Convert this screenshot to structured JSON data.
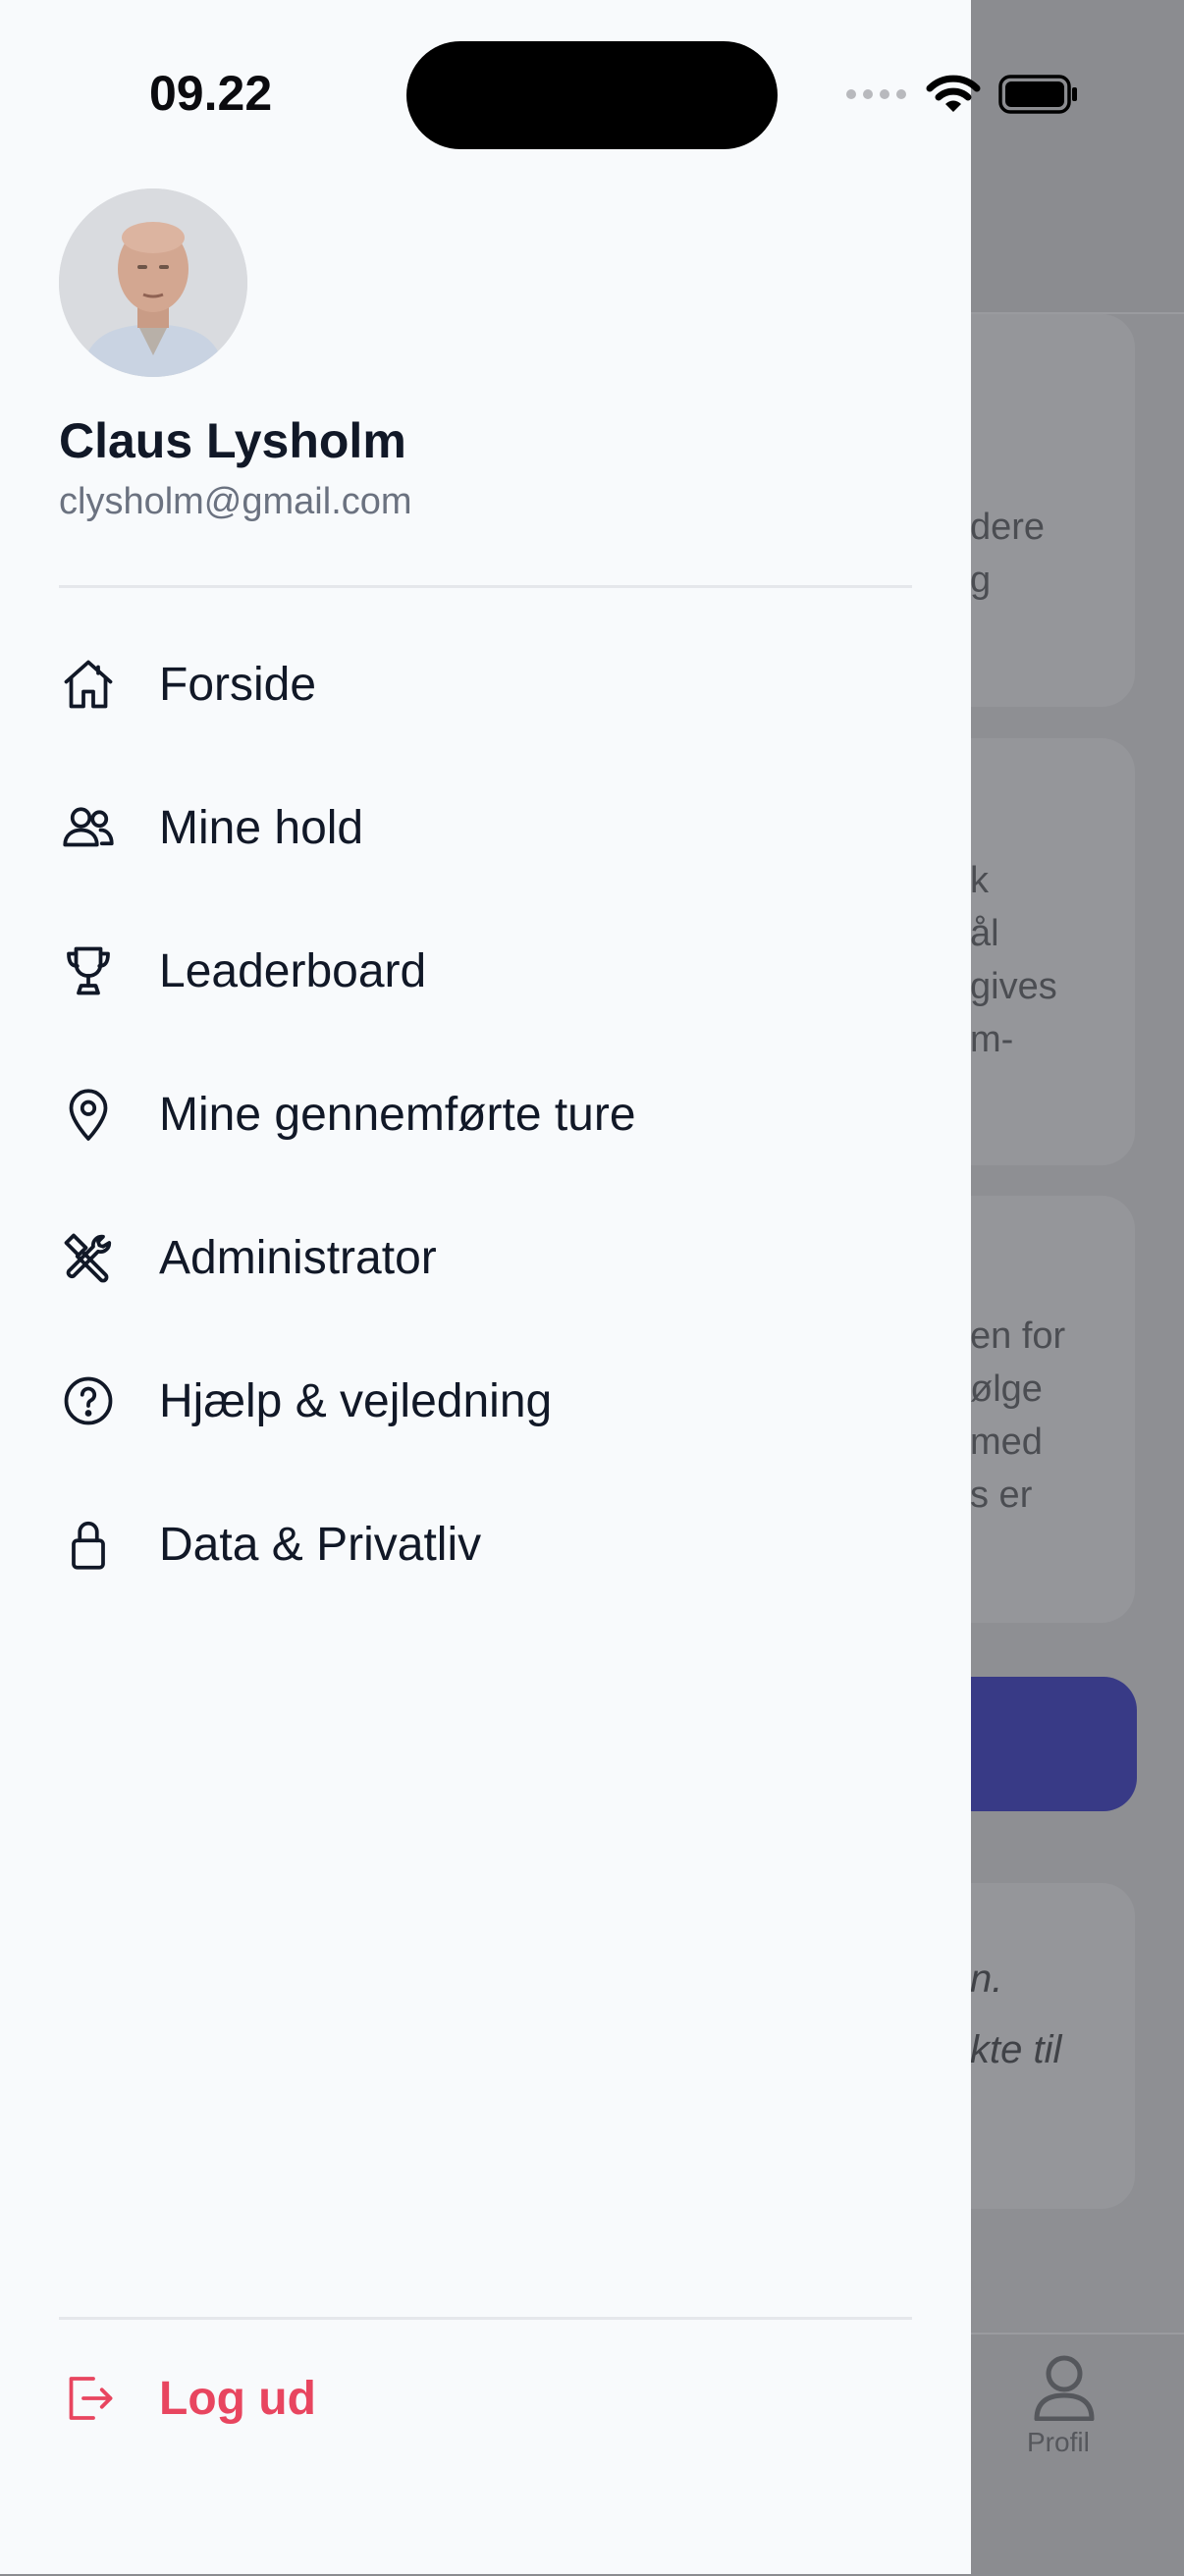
{
  "status_bar": {
    "time": "09.22"
  },
  "background": {
    "card_texts": [
      "dere\ng",
      "k\nål\ngives\nm-",
      "en for\nølge\nmed\ns er"
    ],
    "quote_text": "n.\nkte til",
    "tab_profile_label": "Profil"
  },
  "user": {
    "name": "Claus Lysholm",
    "email": "clysholm@gmail.com"
  },
  "menu": {
    "items": [
      {
        "label": "Forside",
        "icon": "home-icon"
      },
      {
        "label": "Mine hold",
        "icon": "users-icon"
      },
      {
        "label": "Leaderboard",
        "icon": "trophy-icon"
      },
      {
        "label": "Mine gennemførte ture",
        "icon": "map-pin-icon"
      },
      {
        "label": "Administrator",
        "icon": "tools-icon"
      },
      {
        "label": "Hjælp & vejledning",
        "icon": "help-circle-icon"
      },
      {
        "label": "Data & Privatliv",
        "icon": "lock-icon"
      }
    ],
    "logout": {
      "label": "Log ud",
      "icon": "logout-icon"
    }
  },
  "colors": {
    "drawer_bg": "#f8fafc",
    "text_primary": "#111827",
    "text_secondary": "#6b7280",
    "logout": "#e8455f",
    "overlay": "#8e8f93",
    "bg_button": "#383a86"
  }
}
